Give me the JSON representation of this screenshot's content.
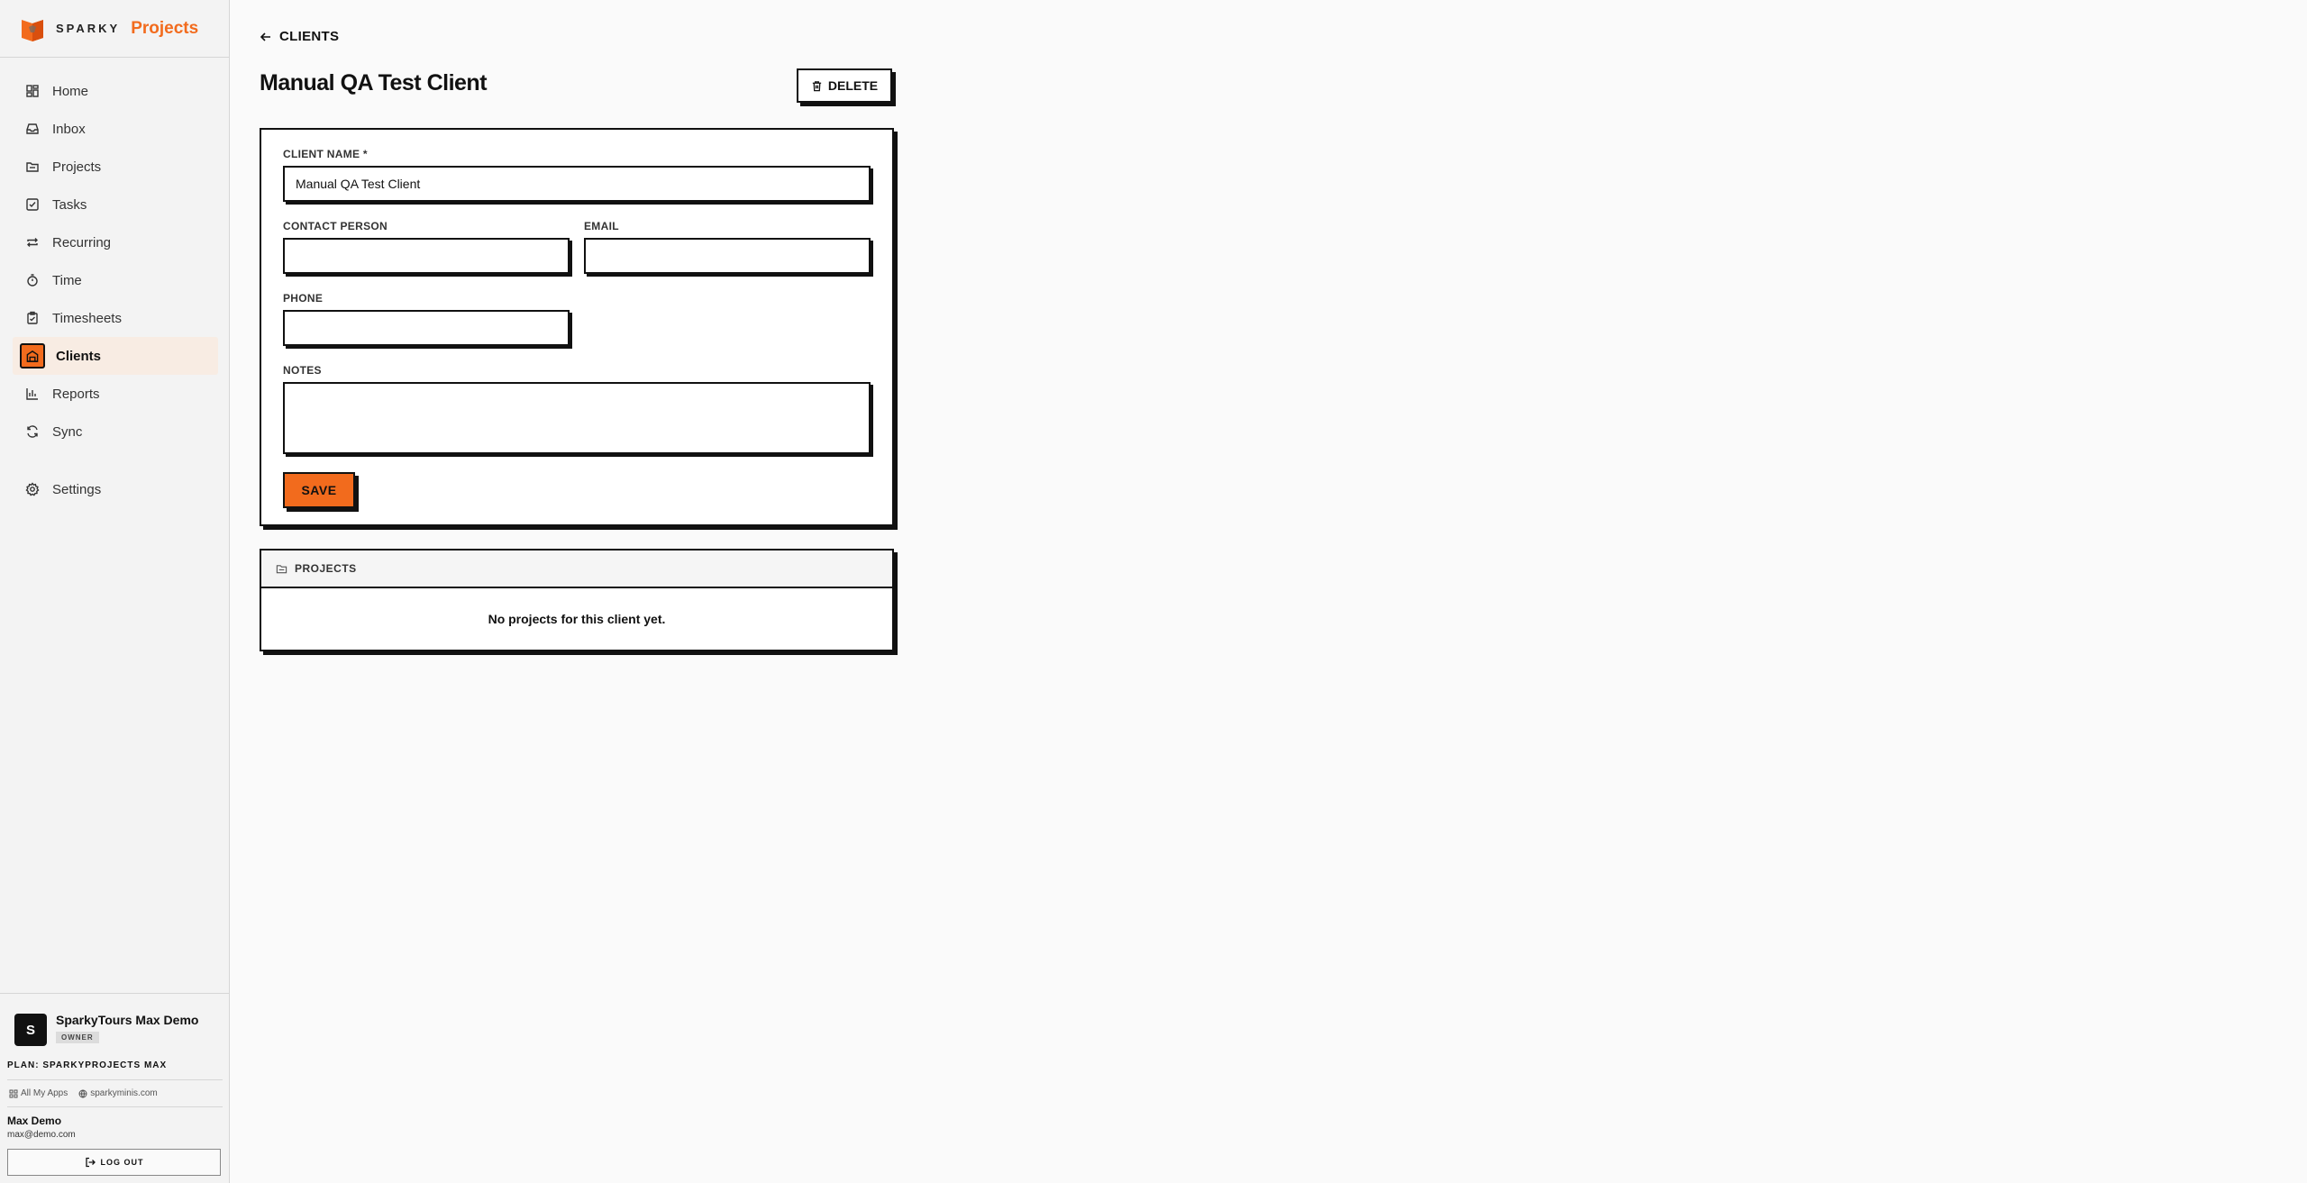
{
  "brand": {
    "name": "SPARKY",
    "product": "Projects",
    "accent": "#f26b1d"
  },
  "sidebar": {
    "items": [
      {
        "label": "Home",
        "icon": "dashboard-icon"
      },
      {
        "label": "Inbox",
        "icon": "inbox-icon"
      },
      {
        "label": "Projects",
        "icon": "folder-icon"
      },
      {
        "label": "Tasks",
        "icon": "checkbox-icon"
      },
      {
        "label": "Recurring",
        "icon": "repeat-icon"
      },
      {
        "label": "Time",
        "icon": "timer-icon"
      },
      {
        "label": "Timesheets",
        "icon": "clipboard-icon"
      },
      {
        "label": "Clients",
        "icon": "building-icon",
        "active": true
      },
      {
        "label": "Reports",
        "icon": "bar-chart-icon"
      },
      {
        "label": "Sync",
        "icon": "refresh-icon"
      }
    ],
    "settings": {
      "label": "Settings",
      "icon": "gear-icon"
    }
  },
  "org": {
    "initial": "S",
    "name": "SparkyTours Max Demo",
    "role": "OWNER"
  },
  "plan": "PLAN: SPARKYPROJECTS MAX",
  "links": {
    "apps": "All My Apps",
    "site": "sparkyminis.com"
  },
  "user": {
    "name": "Max Demo",
    "email": "max@demo.com"
  },
  "logout_label": "LOG OUT",
  "page": {
    "back_label": "CLIENTS",
    "title": "Manual QA Test Client",
    "delete_label": "DELETE"
  },
  "form": {
    "client_name_label": "CLIENT NAME *",
    "client_name_value": "Manual QA Test Client",
    "contact_label": "CONTACT PERSON",
    "contact_value": "",
    "email_label": "EMAIL",
    "email_value": "",
    "phone_label": "PHONE",
    "phone_value": "",
    "notes_label": "NOTES",
    "notes_value": "",
    "save_label": "SAVE"
  },
  "projects": {
    "heading": "PROJECTS",
    "empty": "No projects for this client yet."
  }
}
